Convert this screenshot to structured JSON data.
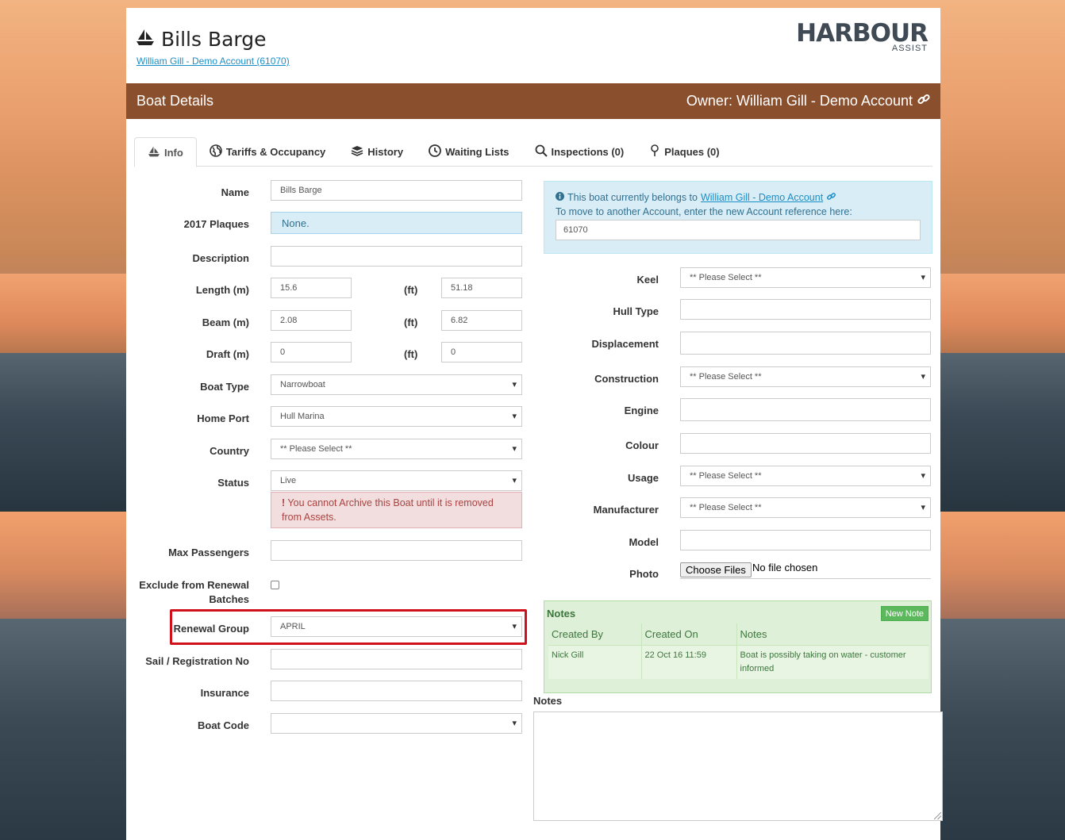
{
  "header": {
    "boat_name": "Bills Barge",
    "account_link": "William Gill - Demo Account (61070)",
    "logo_main": "HARBOUR",
    "logo_sub": "ASSIST"
  },
  "panel": {
    "title": "Boat Details",
    "owner": "Owner: William Gill - Demo Account"
  },
  "tabs": [
    {
      "label": "Info",
      "icon": "boat-icon",
      "active": true
    },
    {
      "label": "Tariffs & Occupancy",
      "icon": "globe-icon"
    },
    {
      "label": "History",
      "icon": "layers-icon"
    },
    {
      "label": "Waiting Lists",
      "icon": "clock-icon"
    },
    {
      "label": "Inspections (0)",
      "icon": "search-icon"
    },
    {
      "label": "Plaques (0)",
      "icon": "pin-icon"
    }
  ],
  "left_form": {
    "name_label": "Name",
    "name_value": "Bills Barge",
    "plaques_label": "2017 Plaques",
    "plaques_value": "None.",
    "description_label": "Description",
    "length_label": "Length (m)",
    "length_m": "15.6",
    "length_ft": "51.18",
    "beam_label": "Beam (m)",
    "beam_m": "2.08",
    "beam_ft": "6.82",
    "draft_label": "Draft (m)",
    "draft_m": "0",
    "draft_ft": "0",
    "ft_label": "(ft)",
    "boat_type_label": "Boat Type",
    "boat_type_value": "Narrowboat",
    "home_port_label": "Home Port",
    "home_port_value": "Hull Marina",
    "country_label": "Country",
    "country_value": "** Please Select **",
    "status_label": "Status",
    "status_value": "Live",
    "status_warning": "You cannot Archive this Boat until it is removed from Assets.",
    "max_passengers_label": "Max Passengers",
    "exclude_label_1": "Exclude from Renewal",
    "exclude_label_2": "Batches",
    "renewal_group_label": "Renewal Group",
    "renewal_group_value": "APRIL",
    "sail_label": "Sail / Registration No",
    "insurance_label": "Insurance",
    "boat_code_label": "Boat Code"
  },
  "account_box": {
    "line1_prefix": "This boat currently belongs to",
    "line1_link": "William Gill - Demo Account",
    "line2": "To move to another Account, enter the new Account reference here:",
    "account_ref": "61070"
  },
  "right_form": {
    "keel_label": "Keel",
    "keel_value": "** Please Select **",
    "hull_label": "Hull Type",
    "displacement_label": "Displacement",
    "construction_label": "Construction",
    "construction_value": "** Please Select **",
    "engine_label": "Engine",
    "colour_label": "Colour",
    "usage_label": "Usage",
    "usage_value": "** Please Select **",
    "manufacturer_label": "Manufacturer",
    "manufacturer_value": "** Please Select **",
    "model_label": "Model",
    "photo_label": "Photo",
    "choose_files": "Choose Files",
    "no_file": "No file chosen"
  },
  "notes": {
    "panel_title": "Notes",
    "new_note_label": "New Note",
    "columns": [
      "Created By",
      "Created On",
      "Notes"
    ],
    "rows": [
      {
        "created_by": "Nick Gill",
        "created_on": "22 Oct 16 11:59",
        "note": "Boat is possibly taking on water - customer informed"
      }
    ],
    "notes_label": "Notes"
  },
  "colors": {
    "panel_header": "#8a4f2d",
    "highlight_border": "#d0101a",
    "info_bg": "#d9edf7",
    "danger_bg": "#f2dede",
    "success_bg": "#dff0d8"
  }
}
